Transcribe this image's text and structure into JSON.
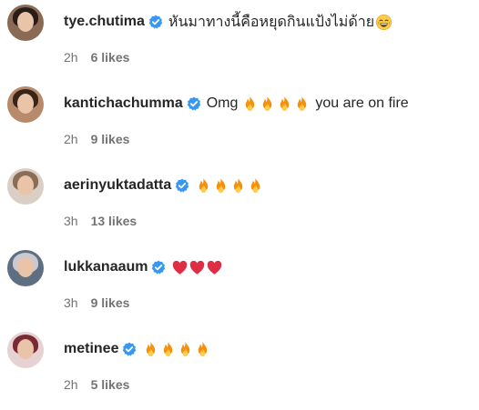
{
  "colors": {
    "verified": "#3897f0",
    "text": "#262626",
    "meta": "#737373",
    "fire_outer": "#f4900c",
    "fire_inner": "#ffcc4d",
    "heart": "#dd2e44"
  },
  "comments": [
    {
      "username": "tye.chutima",
      "verified": true,
      "text": "หันมาทางนี้คือหยุดกินแป้งไม่ด้าย",
      "emojis": [
        "laughing-tears-emoji"
      ],
      "time": "2h",
      "likes": "6 likes",
      "avatar_colors": [
        "#8a6a55",
        "#2a1d18"
      ]
    },
    {
      "username": "kantichachumma",
      "verified": true,
      "text": "Omg",
      "emojis": [
        "fire-emoji",
        "fire-emoji",
        "fire-emoji",
        "fire-emoji"
      ],
      "text_after": "you are on fire",
      "time": "2h",
      "likes": "9 likes",
      "avatar_colors": [
        "#b88a6c",
        "#3a2419"
      ]
    },
    {
      "username": "aerinyuktadatta",
      "verified": true,
      "text": "",
      "emojis": [
        "fire-emoji",
        "fire-emoji",
        "fire-emoji",
        "fire-emoji"
      ],
      "time": "3h",
      "likes": "13 likes",
      "avatar_colors": [
        "#d9cfc4",
        "#8a6d55"
      ]
    },
    {
      "username": "lukkanaaum",
      "verified": true,
      "text": "",
      "emojis": [
        "heart-emoji",
        "heart-emoji",
        "heart-emoji"
      ],
      "time": "3h",
      "likes": "9 likes",
      "avatar_colors": [
        "#5e6f82",
        "#c9c9cf"
      ]
    },
    {
      "username": "metinee",
      "verified": true,
      "text": "",
      "emojis": [
        "fire-emoji",
        "fire-emoji",
        "fire-emoji",
        "fire-emoji"
      ],
      "time": "2h",
      "likes": "5 likes",
      "avatar_colors": [
        "#e6d2d2",
        "#7a2a35"
      ]
    }
  ]
}
